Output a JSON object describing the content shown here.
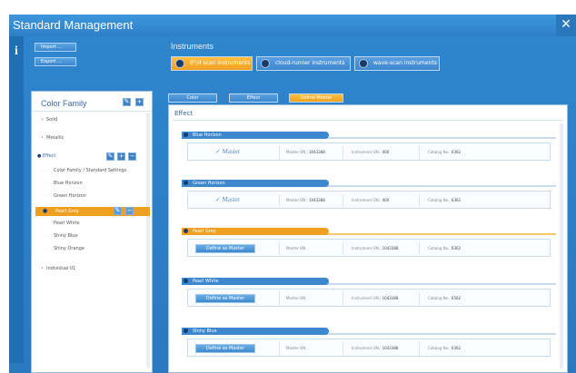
{
  "app": {
    "title": "Standard Management",
    "close": "✕",
    "info": "i"
  },
  "sidebar_actions": {
    "import": "Import ...",
    "export": "Export ..."
  },
  "color_family": {
    "title": "Color Family",
    "items": [
      {
        "label": "Solid"
      },
      {
        "label": "Metallic"
      },
      {
        "label": "Effect"
      },
      {
        "label": "Color Family / Standard Settings"
      },
      {
        "label": "Blue Horizon"
      },
      {
        "label": "Green Horizon"
      },
      {
        "label": "Pearl Grey"
      },
      {
        "label": "Pearl White"
      },
      {
        "label": "Shiny Blue"
      },
      {
        "label": "Shiny Orange"
      },
      {
        "label": "Individual 01"
      }
    ]
  },
  "instruments": {
    "title": "Instruments",
    "buttons": [
      {
        "label": "0°/4 scan instruments"
      },
      {
        "label": "cloud-runner instruments"
      },
      {
        "label": "wave-scan instruments"
      }
    ]
  },
  "tabs": [
    {
      "label": "Color"
    },
    {
      "label": "Effect"
    },
    {
      "label": "Define Master"
    }
  ],
  "content": {
    "title": "Effect",
    "cards": [
      {
        "name": "Blue Horizon",
        "state": "master",
        "master_label": "✓ Master",
        "master_id_label": "Master-ON.:",
        "master_id": "1043388",
        "instrument_label": "Instrument-ON.:",
        "instrument": "400",
        "catalog_label": "Catalog No.:",
        "catalog": "6362"
      },
      {
        "name": "Green Horizon",
        "state": "master",
        "master_label": "✓ Master",
        "master_id_label": "Master-ON.:",
        "master_id": "1043388",
        "instrument_label": "Instrument-ON.:",
        "instrument": "400",
        "catalog_label": "Catalog No.:",
        "catalog": "6362"
      },
      {
        "name": "Pearl Grey",
        "state": "define",
        "define_label": "Define as Master",
        "master_id_label": "Master-ON.:",
        "master_id": "",
        "instrument_label": "Instrument-ON.:",
        "instrument": "1043388",
        "catalog_label": "Catalog No.:",
        "catalog": "6362"
      },
      {
        "name": "Pearl White",
        "state": "define",
        "define_label": "Define as Master",
        "master_id_label": "Master-ON.:",
        "master_id": "",
        "instrument_label": "Instrument-ON.:",
        "instrument": "1043388",
        "catalog_label": "Catalog No.:",
        "catalog": "6562"
      },
      {
        "name": "Shiny Blue",
        "state": "define",
        "define_label": "Define as Master",
        "master_id_label": "Master-ON.:",
        "master_id": "",
        "instrument_label": "Instrument-ON.:",
        "instrument": "1043388",
        "catalog_label": "Catalog No.:",
        "catalog": "6362"
      }
    ]
  },
  "colors": {
    "accent": "#f0a020",
    "primary": "#2d80c7",
    "card_head_blue": "#3d87cf"
  }
}
